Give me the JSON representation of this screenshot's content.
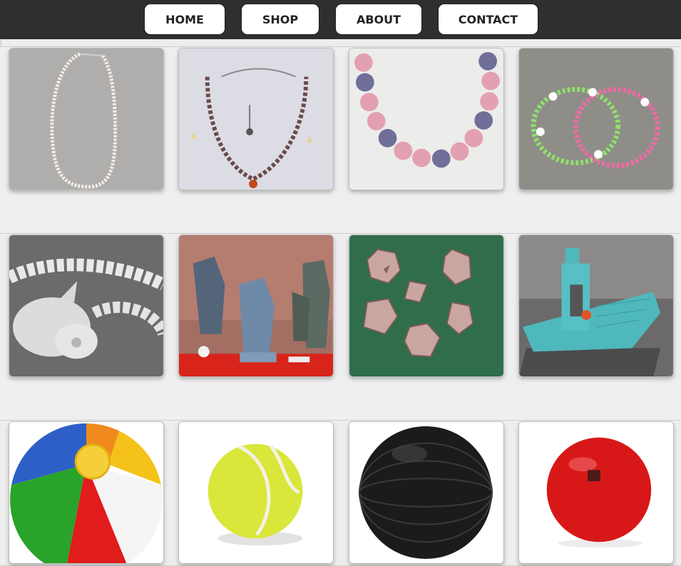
{
  "nav": {
    "items": [
      {
        "label": "HOME"
      },
      {
        "label": "SHOP"
      },
      {
        "label": "ABOUT"
      },
      {
        "label": "CONTACT"
      }
    ]
  },
  "gallery": {
    "rows": [
      {
        "category": "jewelry",
        "items": [
          {
            "icon": "pearl-necklace-image"
          },
          {
            "icon": "beaded-charm-necklace-image"
          },
          {
            "icon": "pink-blue-bead-bracelet-image"
          },
          {
            "icon": "heart-bead-bracelets-image"
          }
        ]
      },
      {
        "category": "3d-prints",
        "items": [
          {
            "icon": "articulated-dragon-image"
          },
          {
            "icon": "miniature-figures-image"
          },
          {
            "icon": "lattice-dice-set-image"
          },
          {
            "icon": "benchy-boat-image"
          }
        ]
      },
      {
        "category": "balls",
        "items": [
          {
            "icon": "beach-ball-image"
          },
          {
            "icon": "tennis-ball-image"
          },
          {
            "icon": "exercise-ball-image"
          },
          {
            "icon": "red-ball-image"
          }
        ]
      }
    ]
  },
  "colors": {
    "navbar": "#2f2f2f",
    "page_background": "#ededed",
    "button_background": "#ffffff"
  }
}
